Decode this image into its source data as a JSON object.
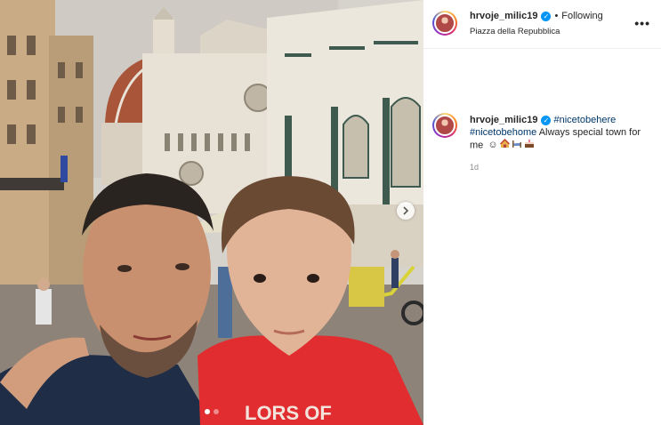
{
  "post": {
    "username": "hrvoje_milic19",
    "verified": true,
    "follow_status": "Following",
    "separator": "•",
    "location": "Piazza della Repubblica",
    "more_icon": "more-options-icon"
  },
  "caption": {
    "username": "hrvoje_milic19",
    "hashtag_1": "#nicetobehere",
    "hashtag_2": "#nicetobehome",
    "text": "Always special town for me",
    "emojis": [
      "smile-emoji",
      "house-emoji",
      "bed-emoji",
      "cake-emoji"
    ],
    "time": "1d"
  },
  "carousel": {
    "slide_count": 2,
    "active_index": 0
  },
  "colors": {
    "accent": "#0095f6",
    "hashtag": "#00376b",
    "muted": "#8e8e8e"
  }
}
